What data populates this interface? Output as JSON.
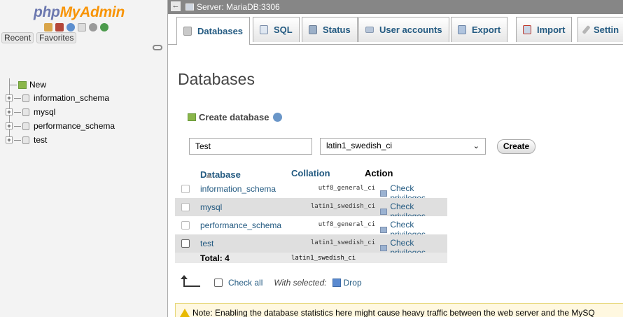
{
  "app": {
    "logo_php": "php",
    "logo_myadmin": "MyAdmin"
  },
  "nav": {
    "icons": [
      "home-icon",
      "sql-window-icon",
      "help-icon",
      "docs-icon",
      "settings-icon",
      "reload-icon"
    ],
    "recent_label": "Recent",
    "favorites_label": "Favorites",
    "new_label": "New",
    "databases": [
      "information_schema",
      "mysql",
      "performance_schema",
      "test"
    ]
  },
  "topbar": {
    "server_label": "Server: MariaDB:3306"
  },
  "menu": {
    "tabs": [
      {
        "label": "Databases",
        "icon": "database-icon"
      },
      {
        "label": "SQL",
        "icon": "sql-icon"
      },
      {
        "label": "Status",
        "icon": "status-icon"
      },
      {
        "label": "User accounts",
        "icon": "users-icon"
      },
      {
        "label": "Export",
        "icon": "export-icon"
      },
      {
        "label": "Import",
        "icon": "import-icon"
      },
      {
        "label": "Settin",
        "icon": "wrench-icon"
      }
    ],
    "active": "Databases"
  },
  "main": {
    "title": "Databases",
    "create_label": "Create database",
    "db_name_value": "Test",
    "collation_value": "latin1_swedish_ci",
    "create_button": "Create"
  },
  "table": {
    "headers": {
      "database": "Database",
      "collation": "Collation",
      "action": "Action"
    },
    "rows": [
      {
        "name": "information_schema",
        "collation": "utf8_general_ci",
        "action": "Check privileges"
      },
      {
        "name": "mysql",
        "collation": "latin1_swedish_ci",
        "action": "Check privileges"
      },
      {
        "name": "performance_schema",
        "collation": "utf8_general_ci",
        "action": "Check privileges"
      },
      {
        "name": "test",
        "collation": "latin1_swedish_ci",
        "action": "Check privileges"
      }
    ],
    "total_label": "Total: 4",
    "total_collation": "latin1_swedish_ci"
  },
  "bulk": {
    "check_all": "Check all",
    "with_selected": "With selected:",
    "drop": "Drop"
  },
  "notice": {
    "text": "Note: Enabling the database statistics here might cause heavy traffic between the web server and the MySQ"
  },
  "colors": {
    "link": "#235a81",
    "topbar": "#868686",
    "logo_php": "#6c78af",
    "logo_myadmin": "#f89406"
  }
}
